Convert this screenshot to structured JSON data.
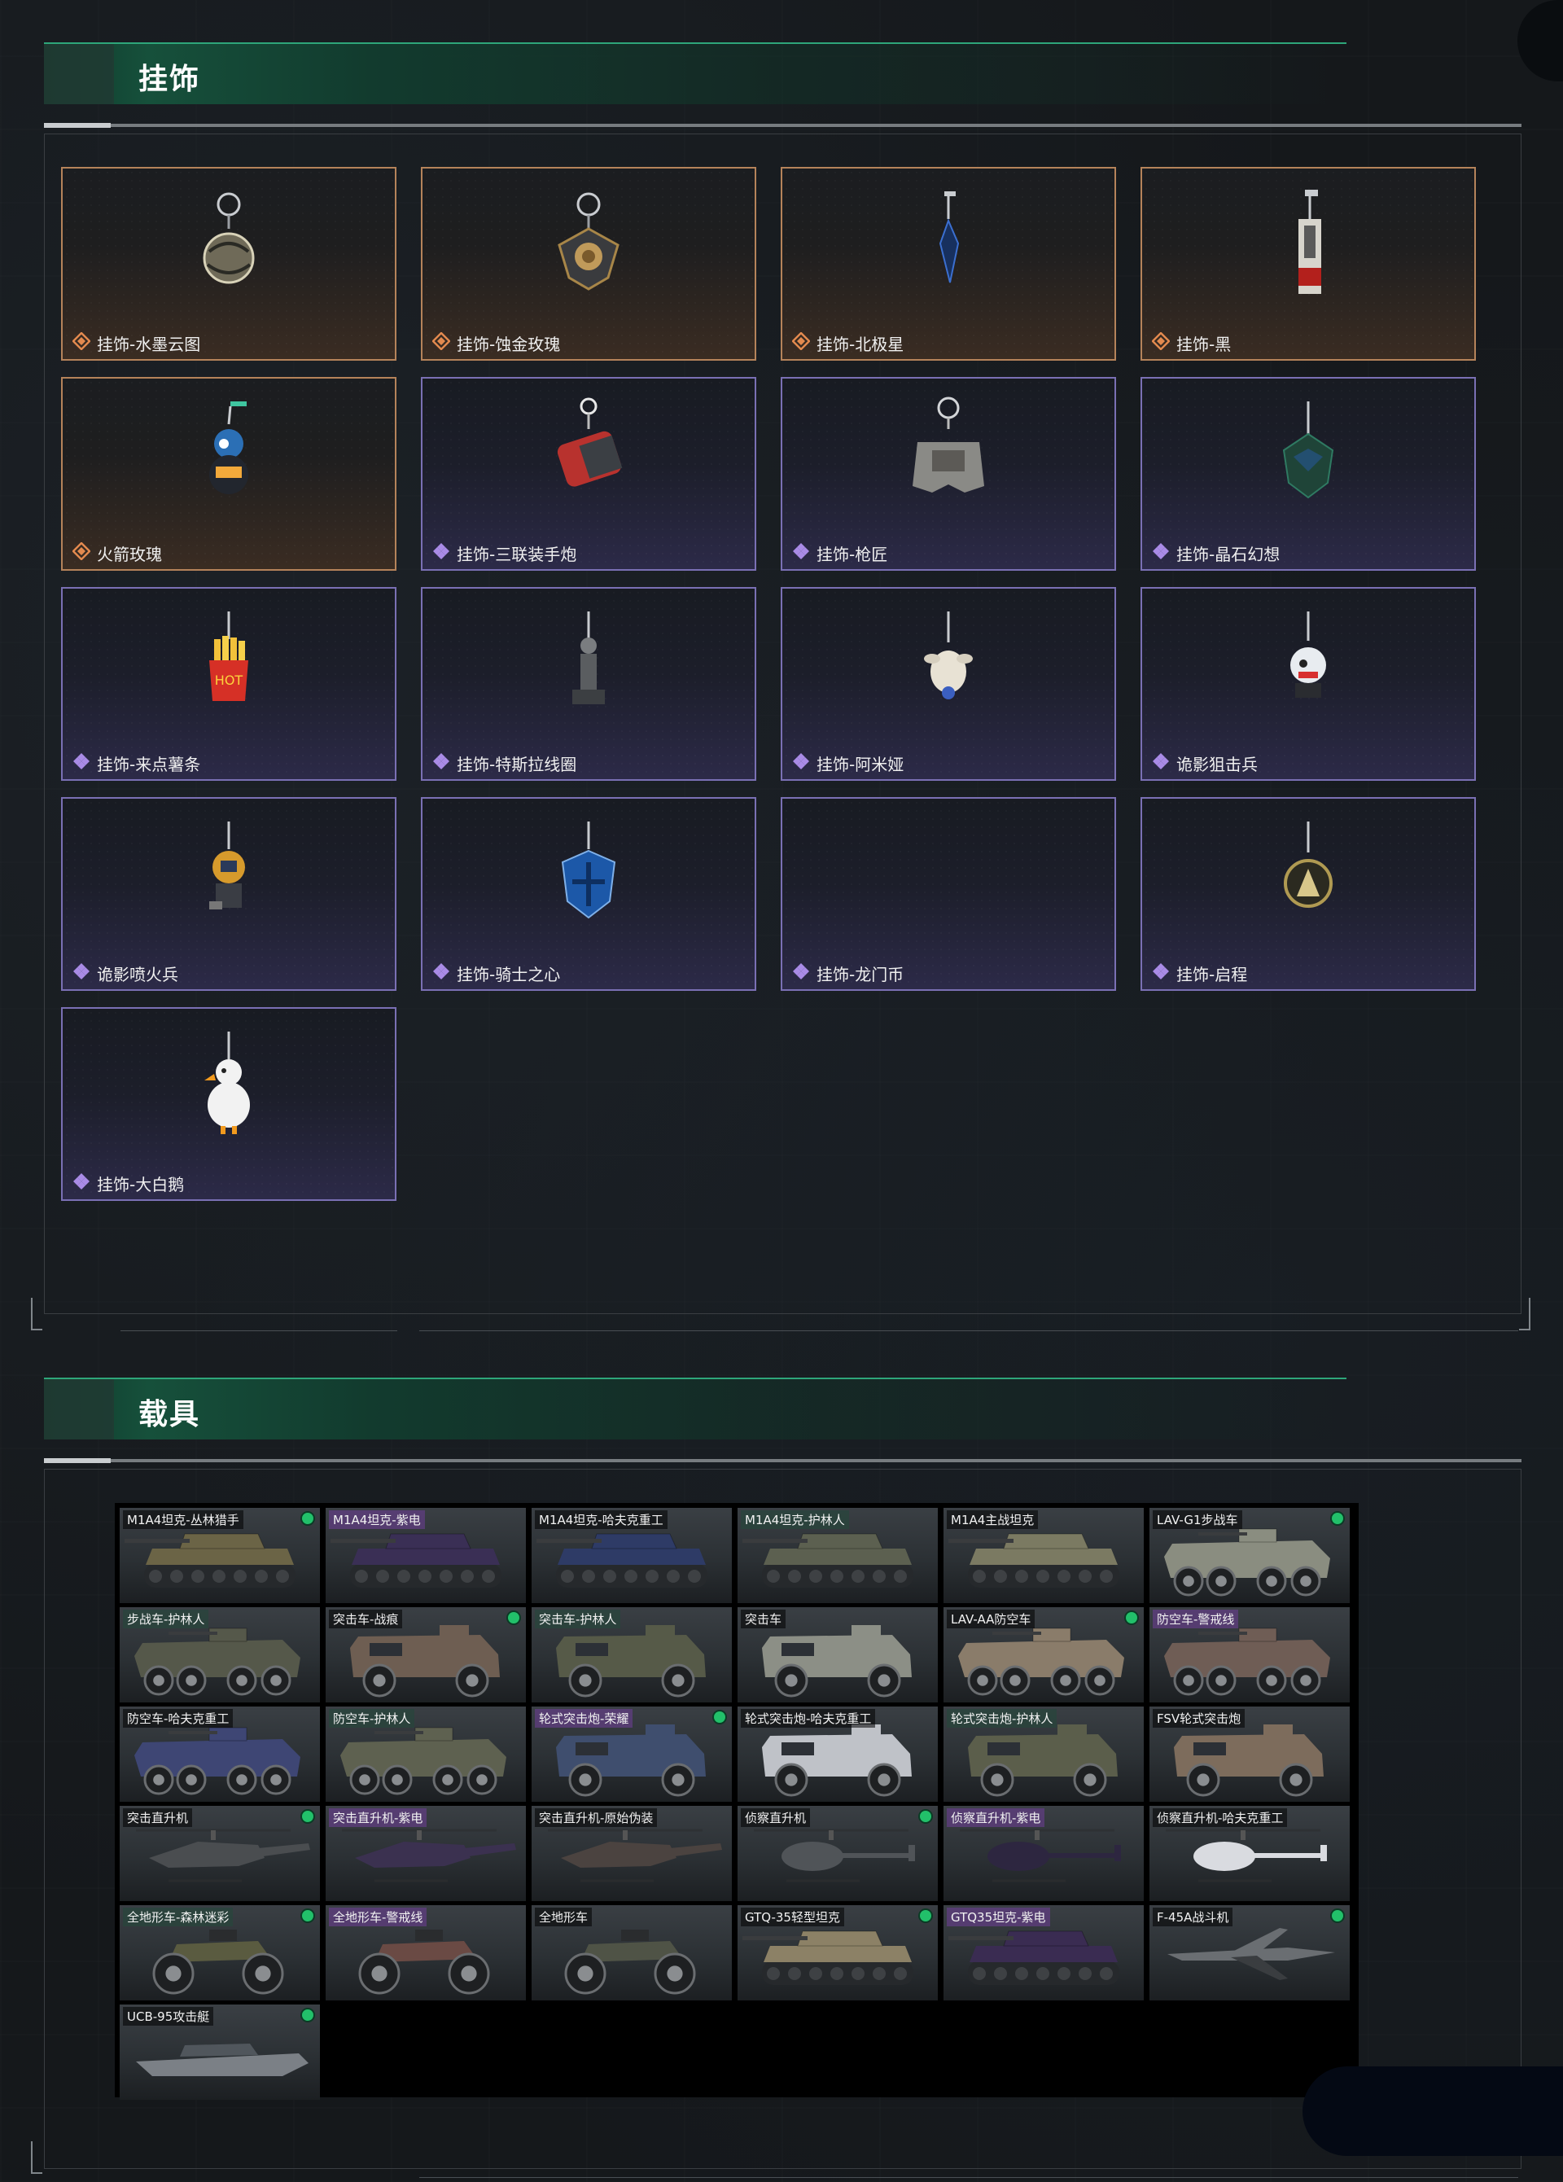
{
  "charms_section": {
    "title": "挂饰"
  },
  "vehicles_section": {
    "title": "载具"
  },
  "charms": [
    {
      "name": "挂饰-水墨云图",
      "rarity": "gold",
      "icon": "orb-charm-icon"
    },
    {
      "name": "挂饰-蚀金玫瑰",
      "rarity": "gold",
      "icon": "rose-charm-icon"
    },
    {
      "name": "挂饰-北极星",
      "rarity": "gold",
      "icon": "star-charm-icon"
    },
    {
      "name": "挂饰-黑",
      "rarity": "gold",
      "icon": "tag-charm-icon"
    },
    {
      "name": "火箭玫瑰",
      "rarity": "gold",
      "icon": "figure-charm-icon"
    },
    {
      "name": "挂饰-三联装手炮",
      "rarity": "purple",
      "icon": "launcher-charm-icon"
    },
    {
      "name": "挂饰-枪匠",
      "rarity": "purple",
      "icon": "case-charm-icon"
    },
    {
      "name": "挂饰-晶石幻想",
      "rarity": "purple",
      "icon": "cube-charm-icon"
    },
    {
      "name": "挂饰-来点薯条",
      "rarity": "purple",
      "icon": "fries-charm-icon"
    },
    {
      "name": "挂饰-特斯拉线圈",
      "rarity": "purple",
      "icon": "coil-charm-icon"
    },
    {
      "name": "挂饰-阿米娅",
      "rarity": "purple",
      "icon": "plush-charm-icon"
    },
    {
      "name": "诡影狙击兵",
      "rarity": "purple",
      "icon": "sniper-charm-icon"
    },
    {
      "name": "诡影喷火兵",
      "rarity": "purple",
      "icon": "flamer-charm-icon"
    },
    {
      "name": "挂饰-骑士之心",
      "rarity": "purple",
      "icon": "shield-charm-icon"
    },
    {
      "name": "挂饰-龙门币",
      "rarity": "purple",
      "icon": ""
    },
    {
      "name": "挂饰-启程",
      "rarity": "purple",
      "icon": "medal-charm-icon"
    },
    {
      "name": "挂饰-大白鹅",
      "rarity": "purple",
      "icon": "goose-charm-icon"
    }
  ],
  "vehicles": [
    {
      "name": "M1A4坦克-丛林猎手",
      "tag": "brown",
      "dot": true,
      "sel": true,
      "kind": "tank",
      "camo": "#6b6446"
    },
    {
      "name": "M1A4坦克-紫电",
      "tag": "p",
      "dot": false,
      "sel": false,
      "kind": "tank",
      "camo": "#3a2f55"
    },
    {
      "name": "M1A4坦克-哈夫克重工",
      "tag": "",
      "dot": false,
      "sel": false,
      "kind": "tank",
      "camo": "#2e3b66"
    },
    {
      "name": "M1A4坦克-护林人",
      "tag": "g",
      "dot": false,
      "sel": false,
      "kind": "tank",
      "camo": "#5c6050"
    },
    {
      "name": "M1A4主战坦克",
      "tag": "",
      "dot": false,
      "sel": false,
      "kind": "tank",
      "camo": "#7b7a62"
    },
    {
      "name": "LAV-G1步战车",
      "tag": "",
      "dot": true,
      "sel": true,
      "kind": "apc",
      "camo": "#8a8d80"
    },
    {
      "name": "步战车-护林人",
      "tag": "g",
      "dot": false,
      "sel": false,
      "kind": "apc",
      "camo": "#55584a"
    },
    {
      "name": "突击车-战痕",
      "tag": "",
      "dot": true,
      "sel": true,
      "kind": "truck",
      "camo": "#6e5e52"
    },
    {
      "name": "突击车-护林人",
      "tag": "g",
      "dot": false,
      "sel": false,
      "kind": "truck",
      "camo": "#565a48"
    },
    {
      "name": "突击车",
      "tag": "",
      "dot": false,
      "sel": false,
      "kind": "truck",
      "camo": "#8c8f86"
    },
    {
      "name": "LAV-AA防空车",
      "tag": "",
      "dot": true,
      "sel": true,
      "kind": "apc",
      "camo": "#8a7c6a"
    },
    {
      "name": "防空车-警戒线",
      "tag": "p",
      "dot": false,
      "sel": false,
      "kind": "apc",
      "camo": "#6f5d55"
    },
    {
      "name": "防空车-哈夫克重工",
      "tag": "",
      "dot": false,
      "sel": false,
      "kind": "apc",
      "camo": "#3e4674"
    },
    {
      "name": "防空车-护林人",
      "tag": "g",
      "dot": false,
      "sel": false,
      "kind": "apc",
      "camo": "#5e6150"
    },
    {
      "name": "轮式突击炮-荣耀",
      "tag": "p",
      "dot": true,
      "sel": true,
      "kind": "truck",
      "camo": "#3f4e6e"
    },
    {
      "name": "轮式突击炮-哈夫克重工",
      "tag": "",
      "dot": false,
      "sel": false,
      "kind": "truck",
      "camo": "#bfc2c8"
    },
    {
      "name": "轮式突击炮-护林人",
      "tag": "g",
      "dot": false,
      "sel": false,
      "kind": "truck",
      "camo": "#5b5e4b"
    },
    {
      "name": "FSV轮式突击炮",
      "tag": "",
      "dot": false,
      "sel": false,
      "kind": "truck",
      "camo": "#7d6c5c"
    },
    {
      "name": "突击直升机",
      "tag": "",
      "dot": true,
      "sel": true,
      "kind": "heli",
      "camo": "#4a4d50"
    },
    {
      "name": "突击直升机-紫电",
      "tag": "p",
      "dot": false,
      "sel": false,
      "kind": "heli",
      "camo": "#3b3150"
    },
    {
      "name": "突击直升机-原始伪装",
      "tag": "",
      "dot": false,
      "sel": false,
      "kind": "heli",
      "camo": "#4b4340"
    },
    {
      "name": "侦察直升机",
      "tag": "",
      "dot": true,
      "sel": true,
      "kind": "heli-s",
      "camo": "#505458"
    },
    {
      "name": "侦察直升机-紫电",
      "tag": "p",
      "dot": false,
      "sel": false,
      "kind": "heli-s",
      "camo": "#2d2640"
    },
    {
      "name": "侦察直升机-哈夫克重工",
      "tag": "",
      "dot": false,
      "sel": false,
      "kind": "heli-s",
      "camo": "#d9dbe0"
    },
    {
      "name": "全地形车-森林迷彩",
      "tag": "g",
      "dot": true,
      "sel": true,
      "kind": "atv",
      "camo": "#5a5b40"
    },
    {
      "name": "全地形车-警戒线",
      "tag": "p",
      "dot": false,
      "sel": false,
      "kind": "atv",
      "camo": "#6a4a44"
    },
    {
      "name": "全地形车",
      "tag": "",
      "dot": false,
      "sel": false,
      "kind": "atv",
      "camo": "#4f5346"
    },
    {
      "name": "GTQ-35轻型坦克",
      "tag": "",
      "dot": true,
      "sel": true,
      "kind": "tank",
      "camo": "#8c8166"
    },
    {
      "name": "GTQ35坦克-紫电",
      "tag": "p",
      "dot": false,
      "sel": false,
      "kind": "tank",
      "camo": "#3a2c52"
    },
    {
      "name": "F-45A战斗机",
      "tag": "",
      "dot": true,
      "sel": true,
      "kind": "jet",
      "camo": "#6a6e72"
    },
    {
      "name": "UCB-95攻击艇",
      "tag": "",
      "dot": true,
      "sel": true,
      "kind": "boat",
      "camo": "#7b8086"
    }
  ],
  "colors": {
    "accent_green": "#2ea67a",
    "gold_rarity": "#e38a4f",
    "purple_rarity": "#a98be6",
    "status_dot": "#22c06a"
  }
}
